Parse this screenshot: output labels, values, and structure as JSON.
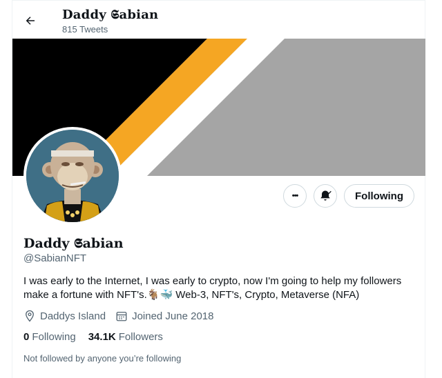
{
  "header": {
    "name": "Daddy 𝕾abian",
    "tweet_count": "815 Tweets"
  },
  "profile": {
    "name": "Daddy 𝕾abian",
    "handle": "@SabianNFT",
    "bio_line1": "I was early to the Internet, I was early to crypto, now I'm going to help my followers",
    "bio_line2_prefix": "make a fortune with NFT's.",
    "bio_emoji": "🐐🐳",
    "bio_line2_suffix": " Web-3, NFT's, Crypto, Metaverse (NFA)",
    "location": "Daddys Island",
    "joined": "Joined June 2018",
    "following_count": "0",
    "following_label": "Following",
    "followers_count": "34.1K",
    "followers_label": "Followers",
    "mutual_note": "Not followed by anyone you’re following"
  },
  "actions": {
    "more_label": "•••",
    "follow_button": "Following"
  },
  "colors": {
    "banner_black": "#000000",
    "banner_stripe": "#f5a623",
    "banner_gray": "#a5a5a5",
    "avatar_bg": "#3f6f86"
  },
  "icons": {
    "back": "arrow-left-icon",
    "more": "more-dots-icon",
    "notify": "bell-icon",
    "location": "location-pin-icon",
    "calendar": "calendar-icon"
  }
}
